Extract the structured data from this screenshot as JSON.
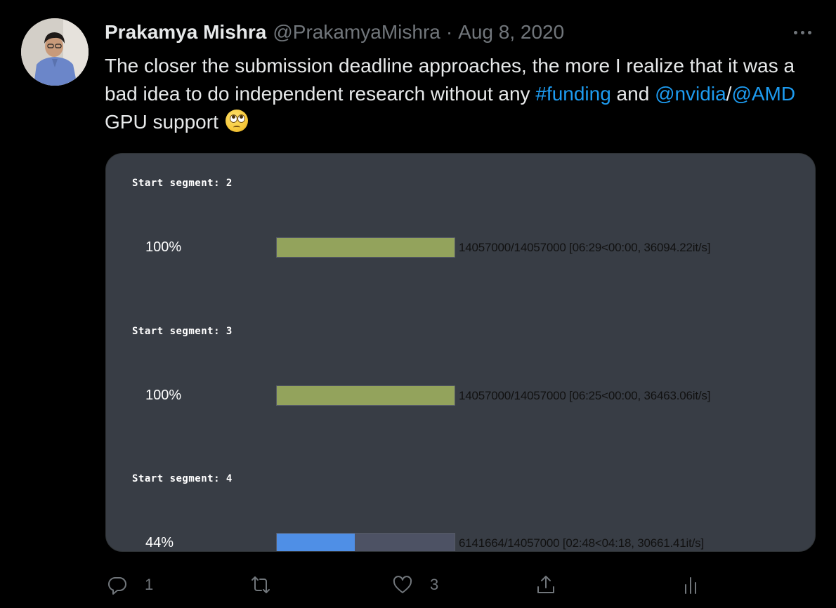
{
  "tweet": {
    "author_name": "Prakamya Mishra",
    "author_handle": "@PrakamyaMishra",
    "separator": "·",
    "date": "Aug 8, 2020",
    "text_parts": {
      "p1": "The closer the submission deadline approaches, the more I realize that it was a bad idea to do independent research without any ",
      "hashtag": "#funding",
      "p2": " and ",
      "mention1": "@nvidia",
      "slash": "/",
      "mention2": "@AMD",
      "p3": " GPU support "
    },
    "emoji": "face-with-rolling-eyes"
  },
  "media": {
    "segments": [
      {
        "label": "Start segment: 2",
        "percent": "100%",
        "progress": 1.0,
        "fill_color": "#93a35c",
        "info": "14057000/14057000 [06:29<00:00, 36094.22it/s]"
      },
      {
        "label": "Start segment: 3",
        "percent": "100%",
        "progress": 1.0,
        "fill_color": "#93a35c",
        "info": "14057000/14057000 [06:25<00:00, 36463.06it/s]"
      },
      {
        "label": "Start segment: 4",
        "percent": "44%",
        "progress": 0.44,
        "fill_color": "#4f8fe6",
        "info": "6141664/14057000 [02:48<04:18, 30661.41it/s]"
      }
    ]
  },
  "actions": {
    "reply": {
      "icon": "reply-icon",
      "count": "1"
    },
    "retweet": {
      "icon": "retweet-icon",
      "count": ""
    },
    "like": {
      "icon": "heart-icon",
      "count": "3"
    },
    "share": {
      "icon": "share-icon"
    },
    "analytics": {
      "icon": "analytics-icon"
    }
  },
  "colors": {
    "background": "#000000",
    "text": "#e7e9ea",
    "muted": "#71767b",
    "link": "#1d9bf0",
    "media_bg": "#383d45"
  }
}
